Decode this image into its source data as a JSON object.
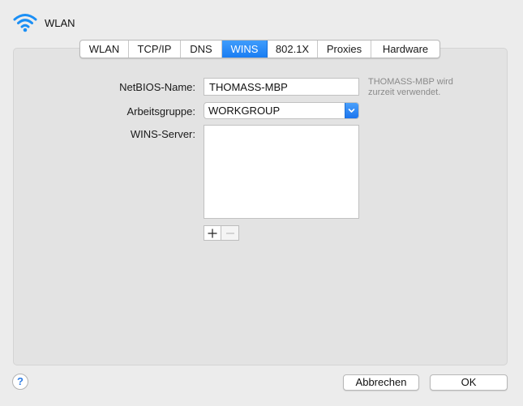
{
  "header": {
    "title": "WLAN",
    "icon": "wifi-icon"
  },
  "tabs": [
    {
      "label": "WLAN",
      "active": false
    },
    {
      "label": "TCP/IP",
      "active": false
    },
    {
      "label": "DNS",
      "active": false
    },
    {
      "label": "WINS",
      "active": true
    },
    {
      "label": "802.1X",
      "active": false
    },
    {
      "label": "Proxies",
      "active": false
    },
    {
      "label": "Hardware",
      "active": false
    }
  ],
  "form": {
    "netbios_label": "NetBIOS-Name:",
    "netbios_value": "THOMASS-MBP",
    "netbios_note": "THOMASS-MBP wird zurzeit verwendet.",
    "workgroup_label": "Arbeitsgruppe:",
    "workgroup_value": "WORKGROUP",
    "wins_label": "WINS-Server:",
    "wins_servers": []
  },
  "list_buttons": {
    "add": "+",
    "remove": "−"
  },
  "footer": {
    "help": "?",
    "cancel": "Abbrechen",
    "ok": "OK"
  },
  "colors": {
    "accent": "#1a7df2",
    "panel": "#e3e3e3",
    "window": "#ececec"
  }
}
